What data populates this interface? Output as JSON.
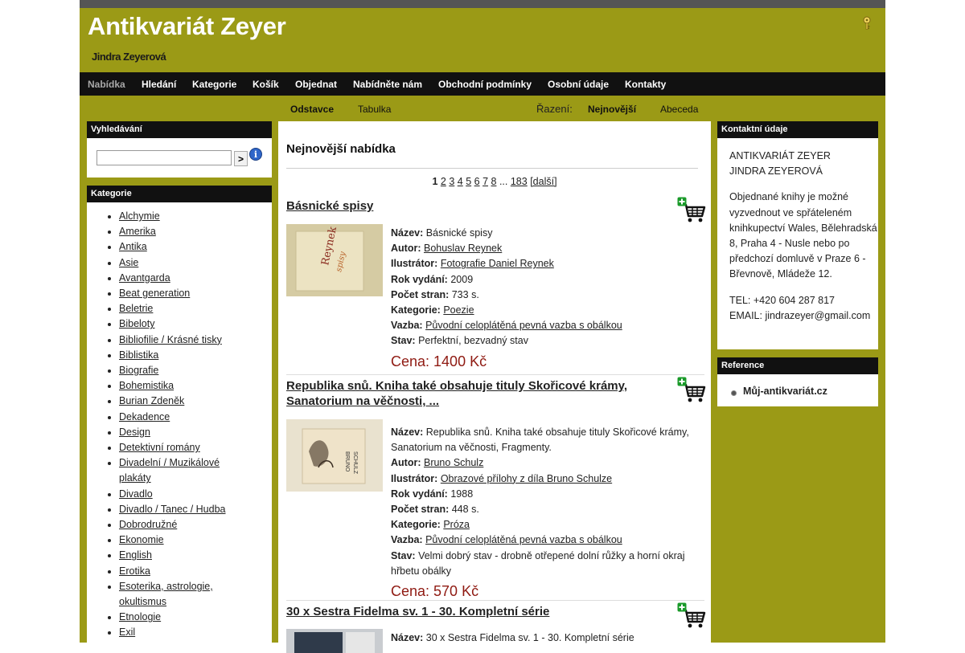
{
  "header": {
    "title": "Antikvariát Zeyer",
    "subtitle": "Jindra Zeyerová"
  },
  "nav": {
    "items": [
      "Nabídka",
      "Hledání",
      "Kategorie",
      "Košík",
      "Objednat",
      "Nabídněte nám",
      "Obchodní podmínky",
      "Osobní údaje",
      "Kontakty"
    ],
    "active": "Nabídka"
  },
  "view_bar": {
    "view_paragraphs": "Odstavce",
    "view_table": "Tabulka",
    "sort_label": "Řazení:",
    "sort_newest": "Nejnovější",
    "sort_alpha": "Abeceda"
  },
  "search": {
    "heading": "Vyhledávání",
    "value": "",
    "button": ">",
    "info_icon": "info-icon"
  },
  "categories": {
    "heading": "Kategorie",
    "items": [
      "Alchymie",
      "Amerika",
      "Antika",
      "Asie",
      "Avantgarda",
      "Beat generation",
      "Beletrie",
      "Bibeloty",
      "Bibliofilie / Krásné tisky",
      "Biblistika",
      "Biografie",
      "Bohemistika",
      "Burian Zdeněk",
      "Dekadence",
      "Design",
      "Detektivní romány",
      "Divadelní / Muzikálové plakáty",
      "Divadlo",
      "Divadlo / Tanec / Hudba",
      "Dobrodružné",
      "Ekonomie",
      "English",
      "Erotika",
      "Esoterika, astrologie, okultismus",
      "Etnologie",
      "Exil"
    ]
  },
  "main": {
    "title": "Nejnovější nabídka",
    "pager": {
      "current": "1",
      "pages": [
        "2",
        "3",
        "4",
        "5",
        "6",
        "7",
        "8"
      ],
      "ellipsis": "...",
      "last": "183",
      "next": "[další]"
    },
    "labels": {
      "name": "Název:",
      "author": "Autor:",
      "illustrator": "Ilustrátor:",
      "year": "Rok vydání:",
      "pages": "Počet stran:",
      "category": "Kategorie:",
      "binding": "Vazba:",
      "condition": "Stav:"
    },
    "products": [
      {
        "title": "Básnické spisy",
        "name": "Básnické spisy",
        "author": "Bohuslav Reynek",
        "illustrator": "Fotografie Daniel Reynek",
        "year": "2009",
        "pages": "733 s.",
        "category": "Poezie",
        "binding": "Původní celoplátěná pevná vazba s obálkou",
        "condition": "Perfektní, bezvadný stav",
        "price": "Cena: 1400 Kč",
        "cover_text": "Bohuslav Reynek Básnické spisy"
      },
      {
        "title": "Republika snů. Kniha také obsahuje tituly Skořicové krámy, Sanatorium na věčnosti, ...",
        "name": "Republika snů. Kniha také obsahuje tituly Skořicové krámy, Sanatorium na věčnosti, Fragmenty.",
        "author": "Bruno Schulz",
        "illustrator": "Obrazové přílohy z díla Bruno Schulze",
        "year": "1988",
        "pages": "448 s.",
        "category": "Próza",
        "binding": "Původní celoplátěná pevná vazba s obálkou",
        "condition": "Velmi dobrý stav - drobně otřepené dolní růžky a horní okraj hřbetu obálky",
        "price": "Cena: 570 Kč",
        "cover_text": "BRUNO SCHULZ"
      },
      {
        "title": "30 x Sestra Fidelma sv. 1 - 30. Kompletní série",
        "name": "30 x Sestra Fidelma sv. 1 - 30. Kompletní série"
      }
    ]
  },
  "contact": {
    "heading": "Kontaktní údaje",
    "name_line1": "ANTIKVARIÁT ZEYER",
    "name_line2": "JINDRA ZEYEROVÁ",
    "pickup": "Objednané knihy je možné vyzvednout ve spřáteleném knihkupectví Wales, Bělehradská 8, Praha 4 - Nusle nebo po předchozí domluvě v Praze 6 - Břevnově, Mládeže 12.",
    "tel": "TEL: +420 604 287 817",
    "email": "EMAIL: jindrazeyer@gmail.com"
  },
  "reference": {
    "heading": "Reference",
    "link": "Můj-antikvariát.cz"
  },
  "colors": {
    "frame": "#9b9a16",
    "nav_bg": "#111111",
    "price": "#8f1a12"
  }
}
